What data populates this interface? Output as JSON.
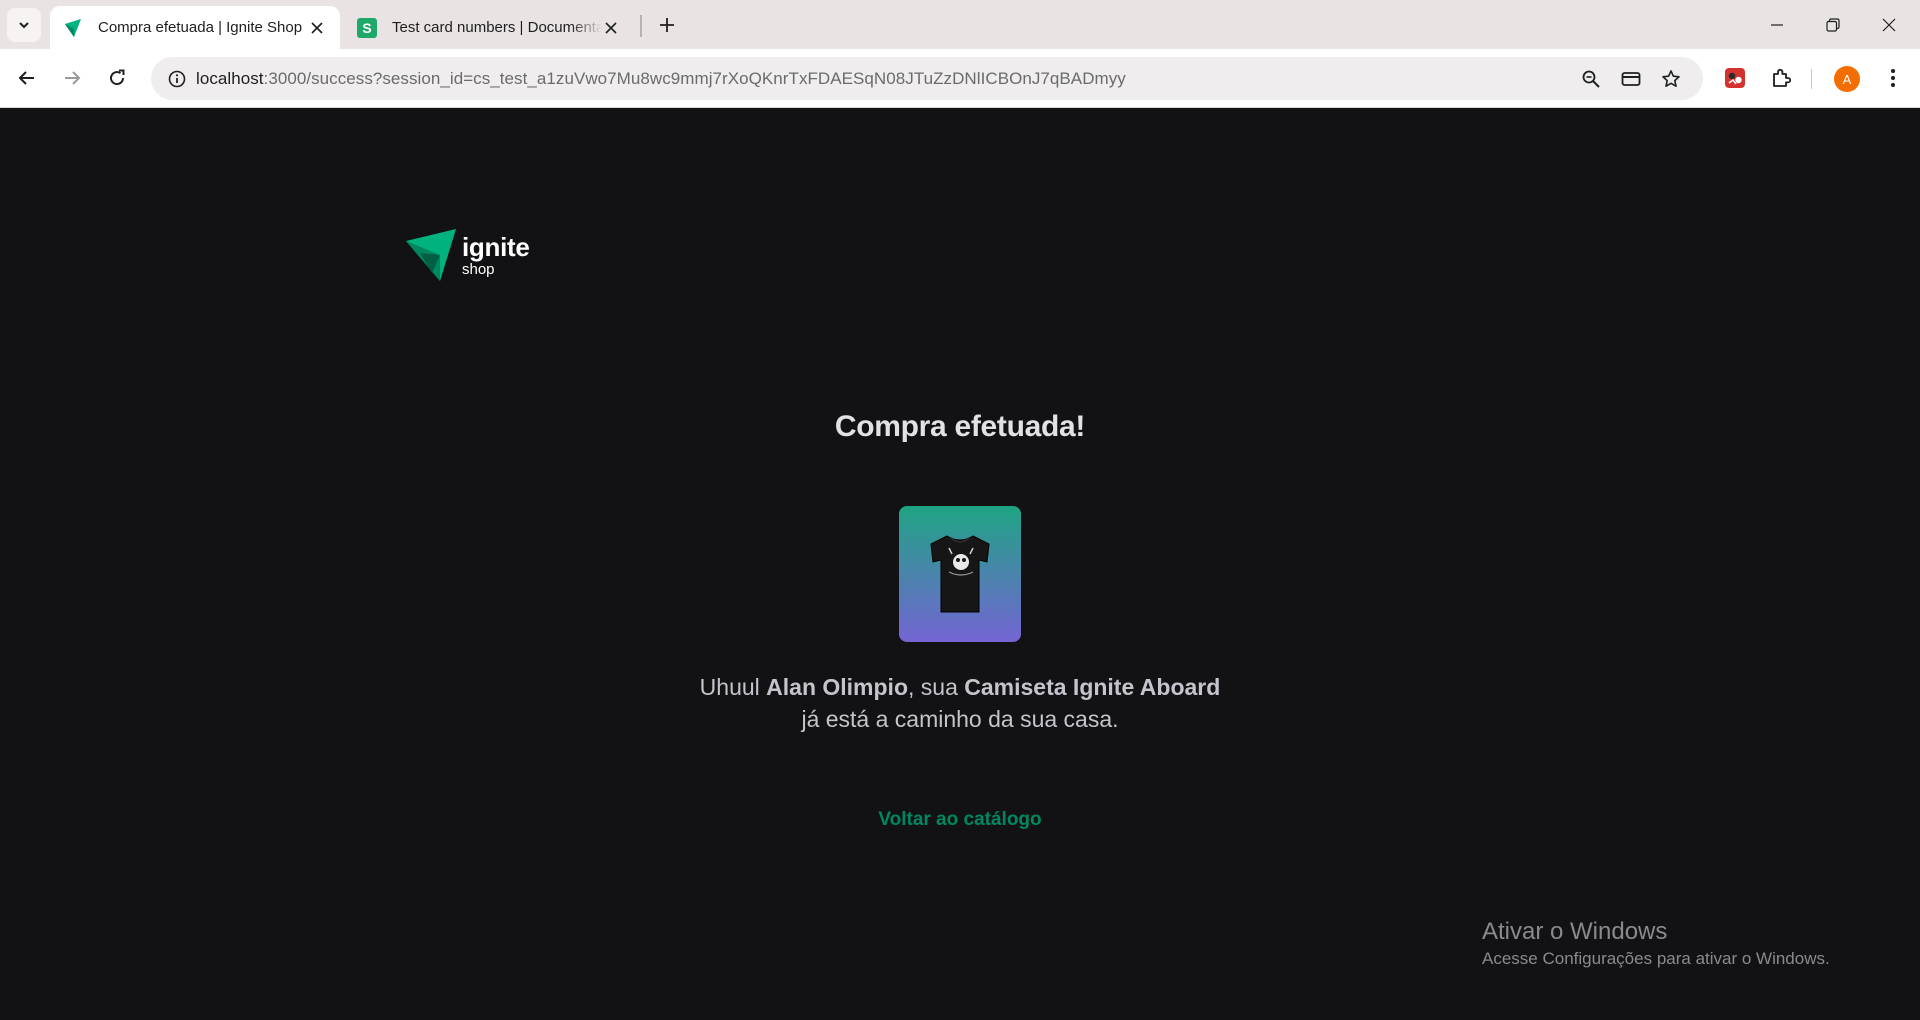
{
  "browser": {
    "tabs": [
      {
        "title": "Compra efetuada | Ignite Shop",
        "active": true
      },
      {
        "title": "Test card numbers | Documentation",
        "active": false
      }
    ],
    "url": {
      "host": "localhost",
      "rest": ":3000/success?session_id=cs_test_a1zuVwo7Mu8wc9mmj7rXoQKnrTxFDAESqN08JTuZzDNlICBOnJ7qBADmyy"
    },
    "profile_initial": "A",
    "colors": {
      "chrome_bg": "#e9e3e3",
      "avatar": "#f36d00"
    }
  },
  "page": {
    "logo": {
      "line1": "ignite",
      "line2": "shop"
    },
    "heading": "Compra efetuada!",
    "message": {
      "prefix": "Uhuul ",
      "customer_name": "Alan Olimpio",
      "middle": ", sua ",
      "product_name": "Camiseta Ignite Aboard",
      "suffix": " já está a caminho da sua casa."
    },
    "back_link": "Voltar ao catálogo",
    "colors": {
      "background": "#121214",
      "accent": "#00875f",
      "title": "#e1e1e6",
      "text": "#c4c4cc"
    }
  },
  "watermark": {
    "line1": "Ativar o Windows",
    "line2": "Acesse Configurações para ativar o Windows."
  }
}
